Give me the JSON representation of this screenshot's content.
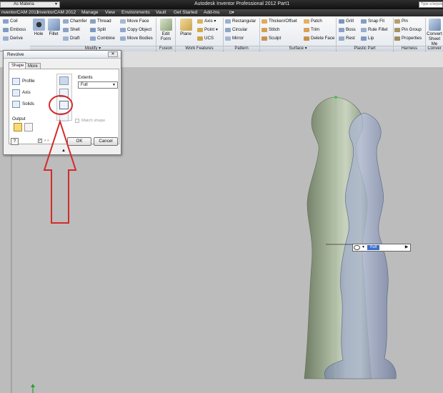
{
  "titlebar": {
    "material": "As Materia",
    "title": "Autodesk Inventor Professional 2012   Part1",
    "search_placeholder": "Type a keyword"
  },
  "menu": [
    "nventorCAM 2011",
    "InventorCAM 2012",
    "Manage",
    "View",
    "Environments",
    "Vault",
    "Get Started",
    "Add-Ins"
  ],
  "ribbon": {
    "left_items": [
      "Coil",
      "Emboss",
      "Derive"
    ],
    "hole_label": "Hole",
    "fillet_label": "Fillet",
    "modify_items": [
      "Chamfer",
      "Shell",
      "Draft",
      "Thread",
      "Split",
      "Combine",
      "Move Face",
      "Copy Object",
      "Move Bodies"
    ],
    "modify_label": "Modify ▾",
    "edit_form_label": "Edit Form",
    "fusion_label": "Fusion",
    "plane_label": "Plane",
    "work_items": [
      "Axis ▾",
      "Point ▾",
      "UCS"
    ],
    "work_label": "Work Features",
    "pattern_items": [
      "Rectangular",
      "Circular",
      "Mirror"
    ],
    "pattern_label": "Pattern",
    "surface_items": [
      "Thicken/Offset",
      "Stitch",
      "Sculpt",
      "Patch",
      "Trim",
      "Delete Face"
    ],
    "surface_label": "Surface ▾",
    "plastic_items": [
      "Grill",
      "Boss",
      "Rest",
      "Snap Fit",
      "Rule Fillet",
      "Lip"
    ],
    "plastic_label": "Plastic Part",
    "harness_items": [
      "Pin",
      "Pin Group",
      "Properties"
    ],
    "harness_label": "Harness",
    "convert_label": "Convert Sheet Me",
    "convert_group_label": "Conver"
  },
  "dialog": {
    "title": "Revolve",
    "tabs": [
      "Shape",
      "More"
    ],
    "profile_label": "Profile",
    "axis_label": "Axis",
    "solids_label": "Solids",
    "output_label": "Output",
    "extents_label": "Extents",
    "extents_value": "Full",
    "match_shape_label": "Match shape",
    "help_label": "?",
    "ok_label": "OK",
    "cancel_label": "Cancel"
  },
  "inline_edit": {
    "value": "Full"
  },
  "colors": {
    "annotation": "#d42a2a",
    "part_body": "#8b9b7f",
    "preview_body": "#9aa7c4"
  }
}
